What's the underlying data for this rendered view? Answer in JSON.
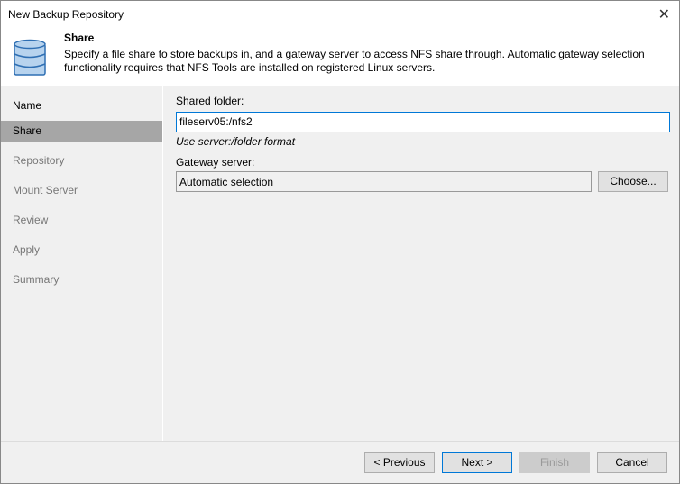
{
  "window": {
    "title": "New Backup Repository"
  },
  "header": {
    "title": "Share",
    "description": "Specify a file share to store backups in, and a gateway server to access NFS share through. Automatic gateway selection functionality requires that NFS Tools are installed on registered Linux servers."
  },
  "sidebar": {
    "items": [
      {
        "label": "Name"
      },
      {
        "label": "Share"
      },
      {
        "label": "Repository"
      },
      {
        "label": "Mount Server"
      },
      {
        "label": "Review"
      },
      {
        "label": "Apply"
      },
      {
        "label": "Summary"
      }
    ]
  },
  "form": {
    "shared_folder_label": "Shared folder:",
    "shared_folder_value": "fileserv05:/nfs2",
    "hint": "Use server:/folder format",
    "gateway_label": "Gateway server:",
    "gateway_value": "Automatic selection",
    "choose_label": "Choose..."
  },
  "footer": {
    "previous": "< Previous",
    "next": "Next >",
    "finish": "Finish",
    "cancel": "Cancel"
  }
}
